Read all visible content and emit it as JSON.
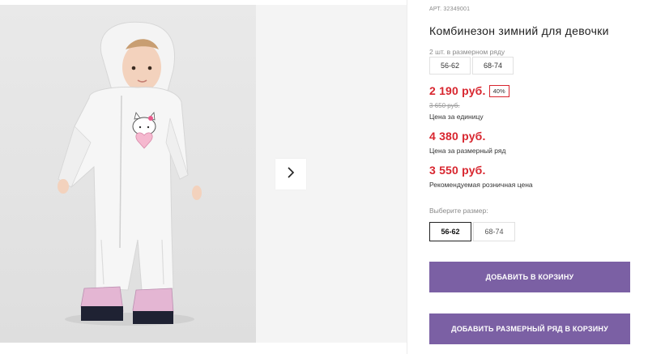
{
  "product": {
    "article": "АРТ. 32349001",
    "title": "Комбинезон зимний для девочки"
  },
  "size_row_info": {
    "note": "2 шт. в размерном ряду",
    "chips": [
      "56-62",
      "68-74"
    ]
  },
  "pricing": {
    "unit_price": "2 190 руб.",
    "discount": "40%",
    "old_price": "3 650 руб.",
    "unit_caption": "Цена за единицу",
    "row_price": "4 380 руб.",
    "row_caption": "Цена за размерный ряд",
    "retail_price": "3 550 руб.",
    "retail_caption": "Рекомендуемая розничная цена"
  },
  "size_select": {
    "label": "Выберите размер:",
    "options": [
      "56-62",
      "68-74"
    ],
    "selected": "56-62"
  },
  "actions": {
    "add_to_cart": "ДОБАВИТЬ В КОРЗИНУ",
    "add_row_to_cart": "ДОБАВИТЬ РАЗМЕРНЫЙ РЯД В КОРЗИНУ"
  },
  "colors": {
    "price_red": "#d8262f",
    "button_purple": "#7b60a4"
  },
  "icons": {
    "gallery_next": "chevron-right-icon"
  }
}
